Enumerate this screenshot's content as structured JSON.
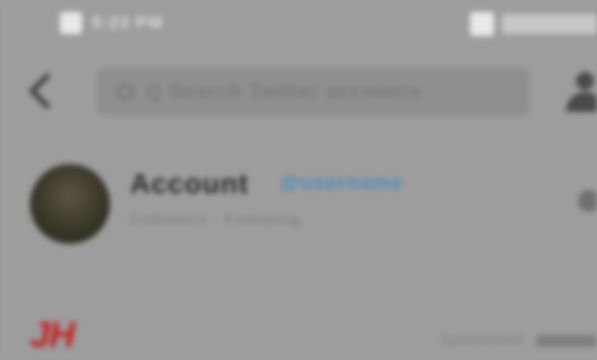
{
  "status_bar": {
    "left_text": "5:23 PM",
    "right_text": "88%"
  },
  "search": {
    "query": "Q  Search Twitter accounts"
  },
  "account": {
    "name": "Account",
    "handle": "@username",
    "subtitle": "Followers · Following"
  },
  "feed": {
    "logo_text": "JH",
    "meta_text": "Sponsored"
  },
  "colors": {
    "background": "#9d9d9d",
    "link_blue": "#4e8bbd",
    "logo_red": "#c21f1f"
  }
}
